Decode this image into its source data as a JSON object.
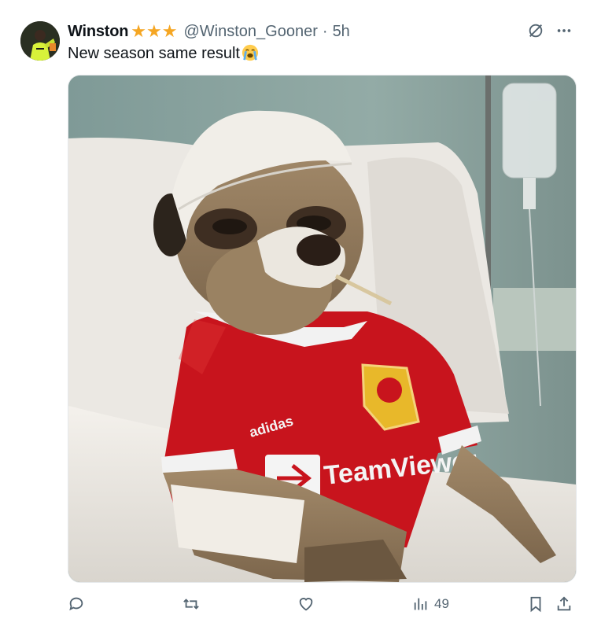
{
  "tweet": {
    "author_name": "Winston",
    "badge_icons": [
      "star-icon",
      "star-icon",
      "star-icon"
    ],
    "handle": "@Winston_Gooner",
    "separator": "·",
    "time": "5h",
    "text": "New season same result",
    "text_emoji": "loudly-crying-face-emoji"
  },
  "media": {
    "type": "photo",
    "jersey_sponsor": "TeamViewer",
    "jersey_brand": "adidas"
  },
  "actions": {
    "reply_count": "",
    "retweet_count": "",
    "like_count": "",
    "views_count": "49"
  },
  "colors": {
    "text": "#0f1419",
    "secondary": "#536471",
    "star": "#f5a623",
    "jersey_red": "#c8141d"
  }
}
